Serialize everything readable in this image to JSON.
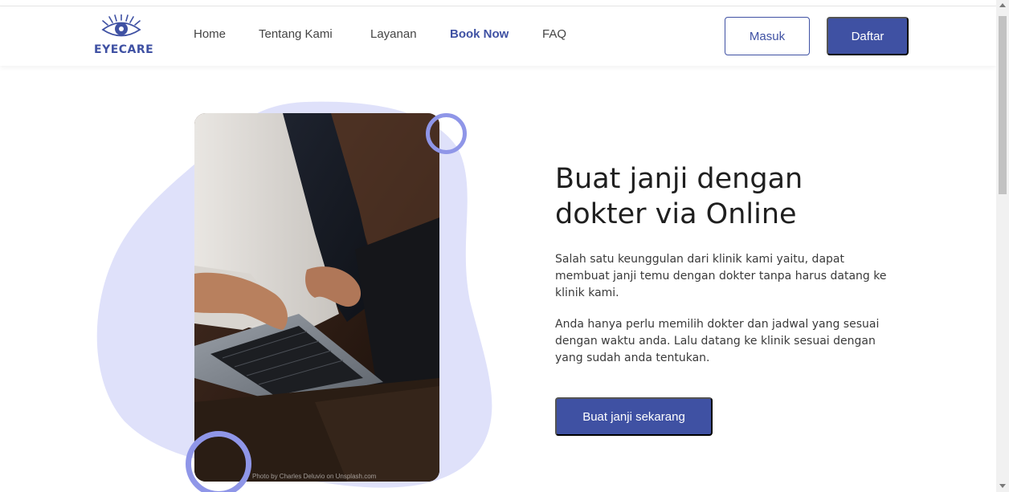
{
  "brand": {
    "name": "EYECARE",
    "logo_icon": "eye-logo-icon",
    "color": "#3f51a3"
  },
  "nav": {
    "links": [
      "Home",
      "Tentang Kami",
      "Layanan",
      "Book Now",
      "FAQ"
    ],
    "active": "Book Now"
  },
  "auth": {
    "login_label": "Masuk",
    "register_label": "Daftar"
  },
  "hero": {
    "title_line1": "Buat janji dengan",
    "title_line2": "dokter via Online",
    "paragraph1": "Salah satu keunggulan dari klinik kami yaitu, dapat membuat janji temu dengan dokter tanpa harus datang ke klinik kami.",
    "paragraph2": "Anda hanya perlu memilih dokter dan jadwal yang sesuai dengan waktu anda. Lalu datang ke klinik sesuai dengan yang sudah anda tentukan.",
    "cta_label": "Buat janji sekarang",
    "photo_credit": "Photo by Charles Deluvio on Unsplash.com"
  },
  "colors": {
    "accent": "#3f51a3",
    "blob": "#dfe1fa",
    "ring": "#8f96e8"
  }
}
